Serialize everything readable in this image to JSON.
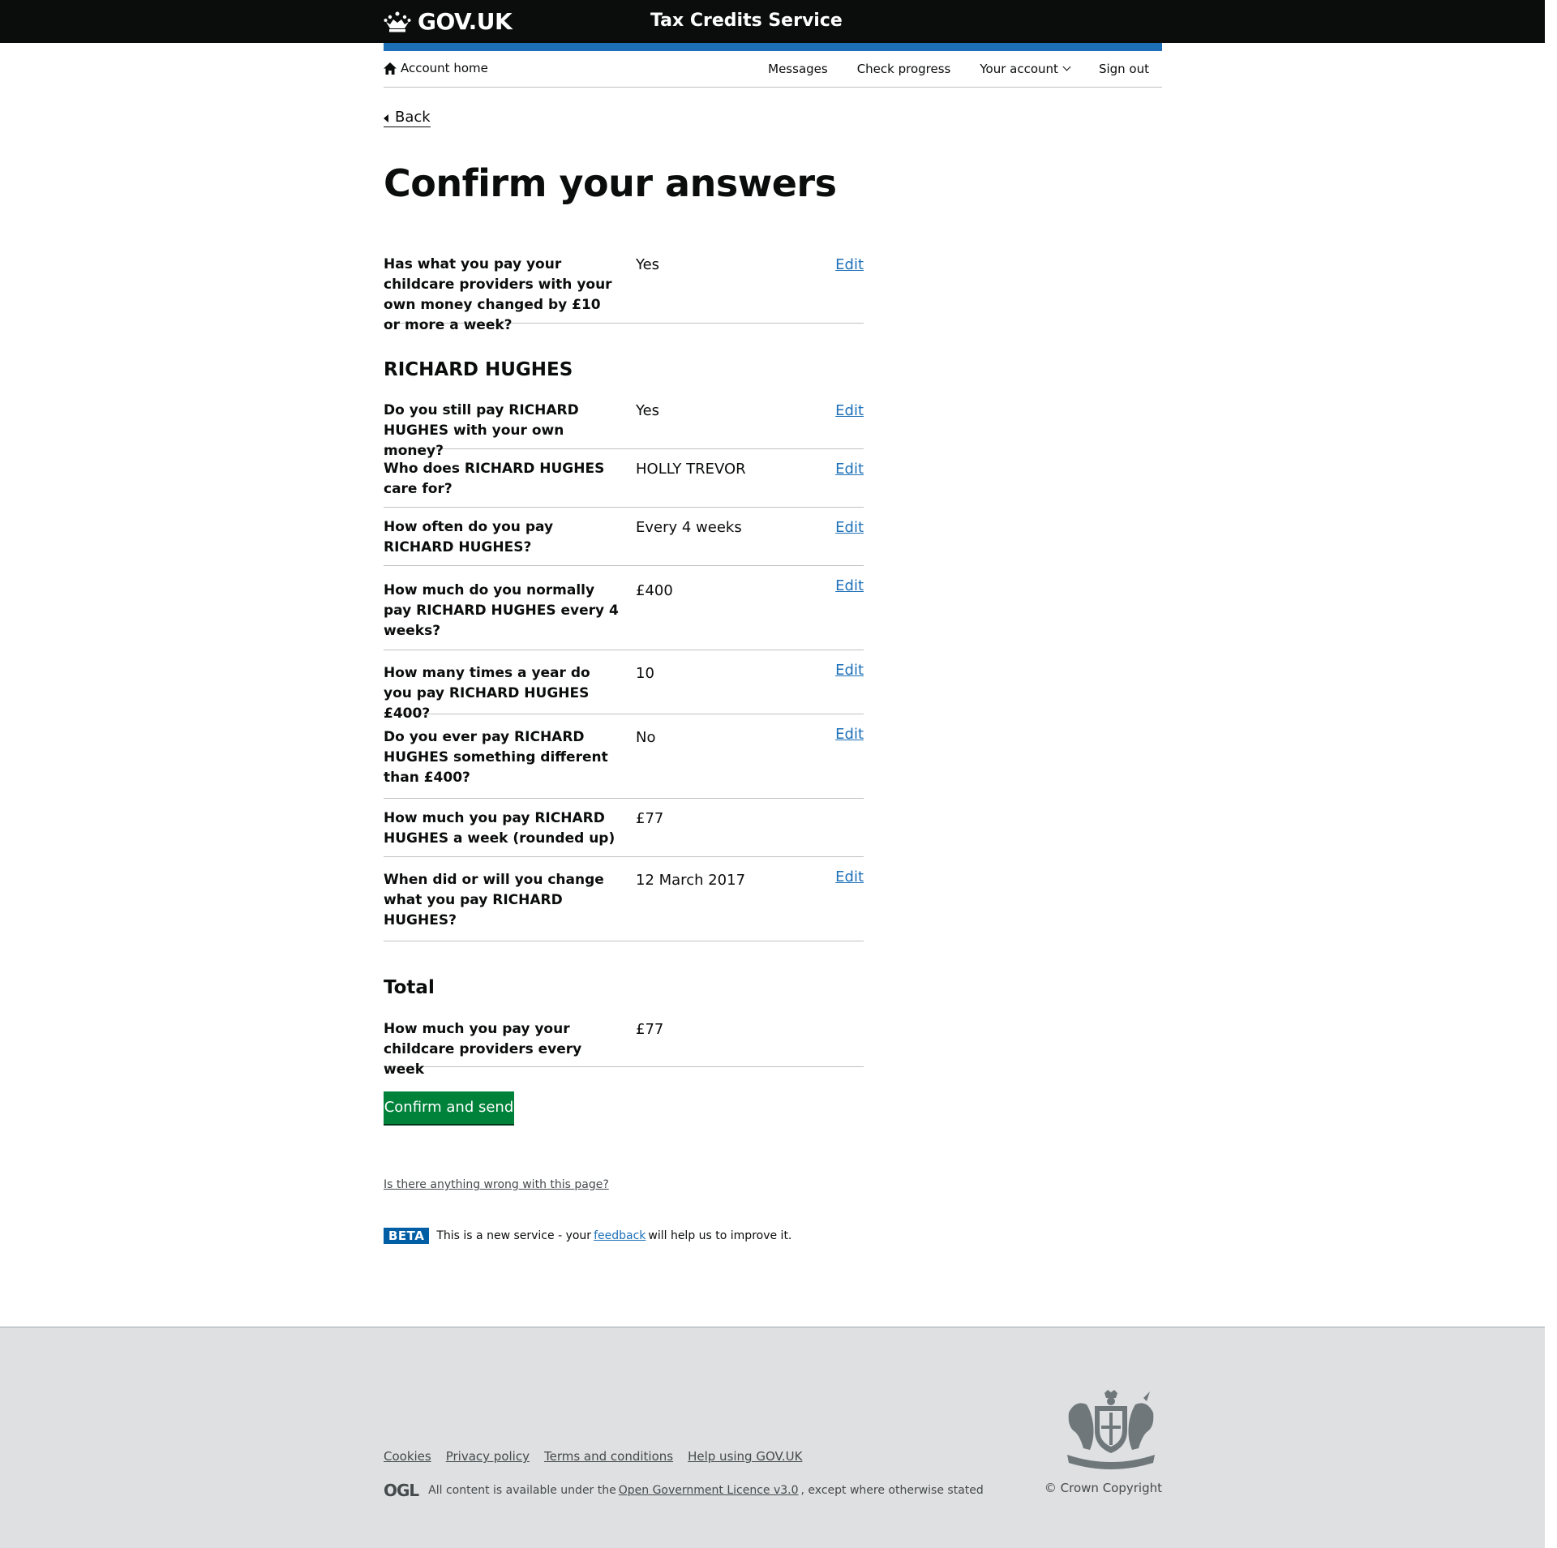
{
  "header": {
    "logo_text": "GOV.UK",
    "service_name": "Tax Credits Service",
    "crown_icon": "crown-icon"
  },
  "account_nav": {
    "home_label": "Account home",
    "home_icon": "home-icon",
    "links": [
      "Messages",
      "Check progress",
      "Your account",
      "Sign out"
    ]
  },
  "back_label": "Back",
  "page_title": "Confirm your answers",
  "edit_label": "Edit",
  "first_row": {
    "question": "Has what you pay your childcare providers with your own money changed by £10 or more a week?",
    "answer": "Yes"
  },
  "provider_heading": "RICHARD HUGHES",
  "provider_rows": [
    {
      "question": "Do you still pay RICHARD HUGHES with your own money?",
      "answer": "Yes"
    },
    {
      "question": "Who does RICHARD HUGHES care for?",
      "answer": "HOLLY TREVOR"
    },
    {
      "question": "How often do you pay RICHARD HUGHES?",
      "answer": "Every 4 weeks"
    },
    {
      "question": "How much do you normally pay RICHARD HUGHES every 4 weeks?",
      "answer": "£400"
    },
    {
      "question": "How many times a year do you pay RICHARD HUGHES £400?",
      "answer": "10"
    },
    {
      "question": "Do you ever pay RICHARD HUGHES something different than £400?",
      "answer": "No"
    },
    {
      "question": "How much you pay RICHARD HUGHES a week (rounded up)",
      "answer": "£77"
    },
    {
      "question": "When did or will you change what you pay RICHARD HUGHES?",
      "answer": "12 March 2017"
    }
  ],
  "total_heading": "Total",
  "total_row": {
    "question": "How much you pay your childcare providers every week",
    "answer": "£77"
  },
  "confirm_button": "Confirm and send",
  "report_link": "Is there anything wrong with this page?",
  "beta": {
    "tag": "BETA",
    "text_before": "This is a new service - your",
    "link": "feedback",
    "text_after": "will help us to improve it."
  },
  "footer": {
    "links": [
      "Cookies",
      "Privacy policy",
      "Terms and conditions",
      "Help using GOV.UK"
    ],
    "ogl_logo": "OGL",
    "licence_before": "All content is available under the",
    "licence_link": "Open Government Licence v3.0",
    "licence_after": ", except where otherwise stated",
    "copyright": "© Crown Copyright",
    "crest_icon": "royal-coat-of-arms-icon"
  },
  "colors": {
    "header_bg": "#0b0c0c",
    "blue_bar": "#1d70b8",
    "link": "#1d70b8",
    "button": "#00823b",
    "beta_tag": "#005ea5",
    "footer_bg": "#dee0e2"
  }
}
